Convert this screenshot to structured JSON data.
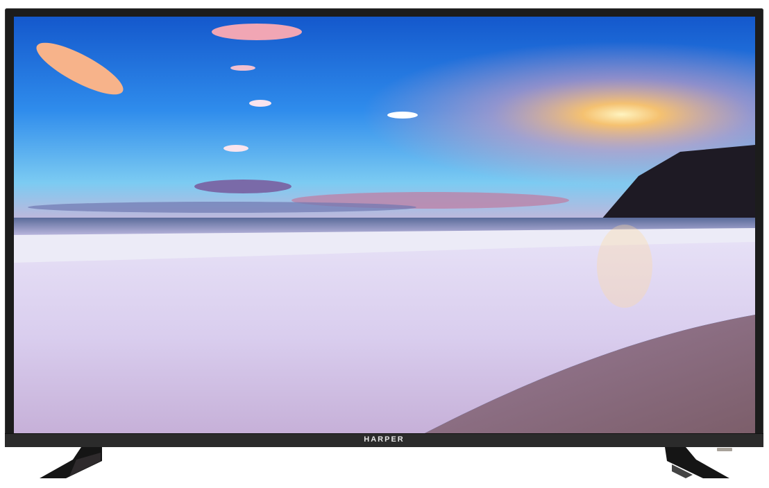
{
  "brand": {
    "logo_text": "HARPER"
  },
  "colors": {
    "bezel": "#1c1c1c",
    "sky_top": "#1560d0",
    "horizon_glow": "#ffc46a",
    "sand": "#8a6a78"
  }
}
